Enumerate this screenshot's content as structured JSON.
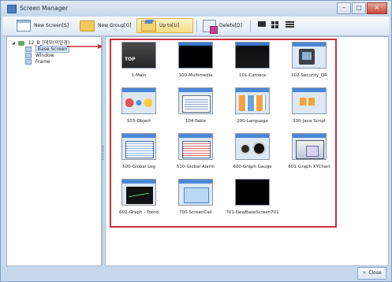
{
  "window": {
    "title": "Screen Manager"
  },
  "window_controls": {
    "minimize": "–",
    "maximize": "□",
    "close": "×"
  },
  "toolbar": {
    "new_screen": "New Screen[S]",
    "new_group": "New Group[G]",
    "up_to": "Up to[U]",
    "delete": "Delete[D]"
  },
  "tree": {
    "project": "12_B_[데모(이민경)",
    "children": [
      {
        "label": "Base Screen",
        "selected": true
      },
      {
        "label": "Window",
        "selected": false
      },
      {
        "label": "Frame",
        "selected": false
      }
    ]
  },
  "screens": [
    {
      "label": "1-Main"
    },
    {
      "label": "100-Multimedia"
    },
    {
      "label": "101-Camera"
    },
    {
      "label": "102-Security_QR"
    },
    {
      "label": "103-Object"
    },
    {
      "label": "104-Table"
    },
    {
      "label": "200-Language"
    },
    {
      "label": "330-Java Script"
    },
    {
      "label": "500-Global Log"
    },
    {
      "label": "510-Global Alarm"
    },
    {
      "label": "600-Graph Gauge"
    },
    {
      "label": "601-Graph XYChart"
    },
    {
      "label": "602-Graph - Trend"
    },
    {
      "label": "700-ScreenCall"
    },
    {
      "label": "701-NewBaseScreen701"
    }
  ],
  "footer": {
    "close": "Close"
  },
  "colors": {
    "highlight": "#c9323f",
    "accent": "#4b87d6",
    "selection": "#d8e7fb"
  }
}
